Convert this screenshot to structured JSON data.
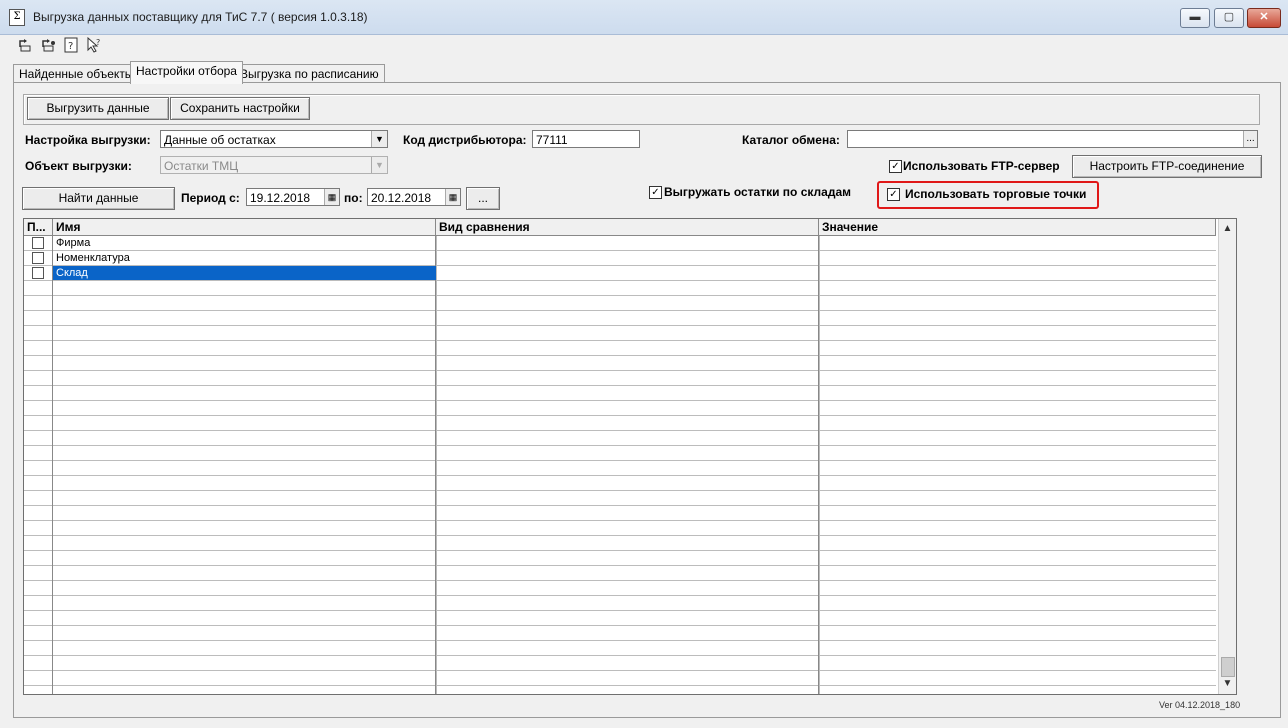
{
  "window": {
    "title": "Выгрузка данных поставщику для ТиС 7.7 ( версия 1.0.3.18)",
    "minimize": "▬",
    "maximize": "▢",
    "close": "✕"
  },
  "toolbar": {
    "icons": [
      "undo-icon",
      "redo-icon",
      "help-icon",
      "context-help-icon"
    ]
  },
  "tabs": [
    "Найденные объекты",
    "Настройки отбора",
    "Выгрузка по расписанию"
  ],
  "active_tab": "Настройки отбора",
  "actions": {
    "export_label": "Выгрузить данные",
    "save_label": "Сохранить настройки"
  },
  "form": {
    "export_setting_label": "Настройка выгрузки:",
    "export_setting_value": "Данные об остатках",
    "distributor_code_label": "Код дистрибьютора:",
    "distributor_code_value": "77111",
    "exchange_catalog_label": "Каталог обмена:",
    "exchange_catalog_value": "",
    "browse_label": "...",
    "export_object_label": "Объект выгрузки:",
    "export_object_value": "Остатки ТМЦ",
    "use_ftp_label": "Использовать FTP-сервер",
    "use_ftp_checked": true,
    "configure_ftp_label": "Настроить FTP-соединение",
    "find_data_label": "Найти данные",
    "period_from_label": "Период с:",
    "period_from_value": "19.12.2018",
    "period_to_label": "по:",
    "period_to_value": "20.12.2018",
    "period_more_label": "...",
    "export_by_warehouse_label": "Выгружать остатки по складам",
    "export_by_warehouse_checked": true,
    "use_trade_points_label": "Использовать торговые точки",
    "use_trade_points_checked": true
  },
  "grid": {
    "columns": [
      "П...",
      "Имя",
      "Вид сравнения",
      "Значение"
    ],
    "rows": [
      {
        "name": "Фирма",
        "comparison": "",
        "value": "",
        "selected": false
      },
      {
        "name": "Номенклатура",
        "comparison": "",
        "value": "",
        "selected": false
      },
      {
        "name": "Склад",
        "comparison": "",
        "value": "",
        "selected": true
      }
    ]
  },
  "version_text": "Ver 04.12.2018_180"
}
